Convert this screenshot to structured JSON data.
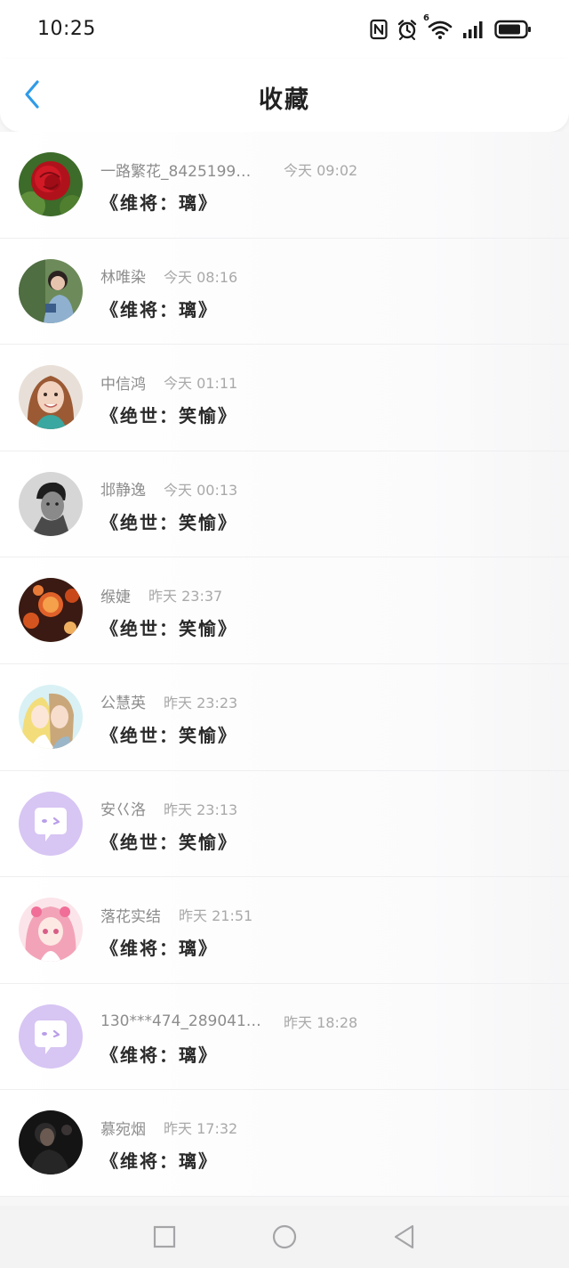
{
  "status_bar": {
    "time": "10:25",
    "icons": [
      "nfc-icon",
      "alarm-icon",
      "wifi-icon",
      "signal-icon",
      "battery-icon"
    ],
    "wifi_badge": "6"
  },
  "header": {
    "title": "收藏",
    "back_icon": "chevron-left-icon",
    "accent_color": "#2f9be8"
  },
  "items": [
    {
      "name": "一路繁花_8425199…",
      "time": "今天 09:02",
      "book": "《维将：璃》",
      "avatar": "rose"
    },
    {
      "name": "林唯染",
      "time": "今天 08:16",
      "book": "《维将：璃》",
      "avatar": "photo-woman-green"
    },
    {
      "name": "中信鸿",
      "time": "今天 01:11",
      "book": "《绝世：笑愉》",
      "avatar": "photo-woman-smile"
    },
    {
      "name": "邶静逸",
      "time": "今天 00:13",
      "book": "《绝世：笑愉》",
      "avatar": "photo-man-bw"
    },
    {
      "name": "缑婕",
      "time": "昨天 23:37",
      "book": "《绝世：笑愉》",
      "avatar": "photo-lanterns"
    },
    {
      "name": "公慧英",
      "time": "昨天 23:23",
      "book": "《绝世：笑愉》",
      "avatar": "anime-couple"
    },
    {
      "name": "安巜洛",
      "time": "昨天 23:13",
      "book": "《绝世：笑愉》",
      "avatar": "default-chat-bubble"
    },
    {
      "name": "落花实结",
      "time": "昨天 21:51",
      "book": "《维将：璃》",
      "avatar": "anime-pink-girl"
    },
    {
      "name": "130***474_289041…",
      "time": "昨天 18:28",
      "book": "《维将：璃》",
      "avatar": "default-chat-bubble"
    },
    {
      "name": "慕宛烟",
      "time": "昨天 17:32",
      "book": "《维将：璃》",
      "avatar": "photo-dark-portrait"
    }
  ],
  "nav_bar": {
    "buttons": [
      "recent-apps-icon",
      "home-icon",
      "back-triangle-icon"
    ]
  }
}
